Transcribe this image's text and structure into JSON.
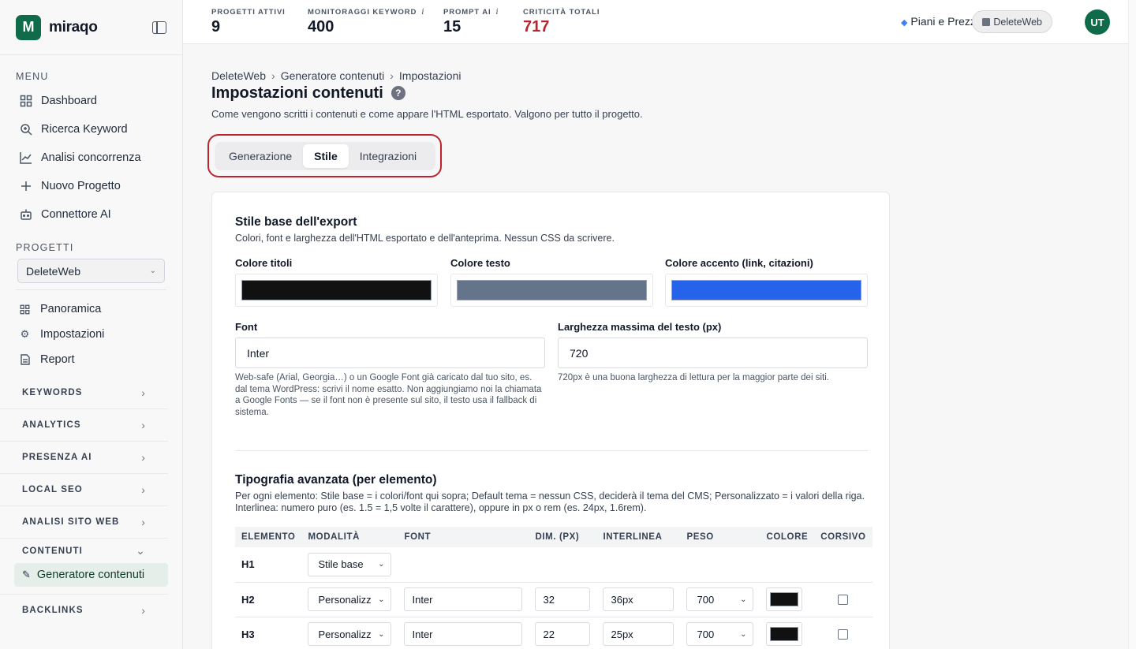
{
  "brand": {
    "name": "miraqo",
    "logo_letter": "M"
  },
  "sidebar": {
    "menu_label": "MENU",
    "menu": [
      {
        "label": "Dashboard",
        "icon": "dashboard-icon"
      },
      {
        "label": "Ricerca Keyword",
        "icon": "search-icon"
      },
      {
        "label": "Analisi concorrenza",
        "icon": "chart-icon"
      },
      {
        "label": "Nuovo Progetto",
        "icon": "plus-icon"
      },
      {
        "label": "Connettore AI",
        "icon": "robot-icon"
      }
    ],
    "projects_label": "PROGETTI",
    "project_selected": "DeleteWeb",
    "project_items": [
      {
        "label": "Panoramica",
        "icon": "grid-icon"
      },
      {
        "label": "Impostazioni",
        "icon": "gear-icon"
      },
      {
        "label": "Report",
        "icon": "document-icon"
      }
    ],
    "groups": [
      "KEYWORDS",
      "ANALYTICS",
      "PRESENZA AI",
      "LOCAL SEO",
      "ANALISI SITO WEB",
      "CONTENUTI"
    ],
    "active_item": "Generatore contenuti",
    "last_group": "BACKLINKS"
  },
  "topbar": {
    "stats": [
      {
        "label": "PROGETTI ATTIVI",
        "value": "9",
        "info": ""
      },
      {
        "label": "MONITORAGGI KEYWORD",
        "value": "400",
        "info": "i"
      },
      {
        "label": "PROMPT AI",
        "value": "15",
        "info": "i"
      },
      {
        "label": "CRITICITÀ TOTALI",
        "value": "717",
        "info": ""
      }
    ],
    "plans": "Piani e Prezzi",
    "workspace": "DeleteWeb",
    "avatar": "UT",
    "accent_red": "#b3262d"
  },
  "breadcrumb": [
    "DeleteWeb",
    "Generatore contenuti",
    "Impostazioni"
  ],
  "page": {
    "title": "Impostazioni contenuti",
    "subtitle": "Come vengono scritti i contenuti e come appare l'HTML esportato. Valgono per tutto il progetto."
  },
  "tabs": [
    {
      "label": "Generazione",
      "active": false
    },
    {
      "label": "Stile",
      "active": true
    },
    {
      "label": "Integrazioni",
      "active": false
    }
  ],
  "style_base": {
    "title": "Stile base dell'export",
    "desc": "Colori, font e larghezza dell'HTML esportato e dell'anteprima. Nessun CSS da scrivere.",
    "colors": [
      {
        "label": "Colore titoli",
        "value": "#111111"
      },
      {
        "label": "Colore testo",
        "value": "#64748b"
      },
      {
        "label": "Colore accento (link, citazioni)",
        "value": "#2563eb"
      }
    ],
    "font_label": "Font",
    "font_value": "Inter",
    "font_hint": "Web-safe (Arial, Georgia…) o un Google Font già caricato dal tuo sito, es. dal tema WordPress: scrivi il nome esatto. Non aggiungiamo noi la chiamata a Google Fonts — se il font non è presente sul sito, il testo usa il fallback di sistema.",
    "width_label": "Larghezza massima del testo (px)",
    "width_value": "720",
    "width_hint": "720px è una buona larghezza di lettura per la maggior parte dei siti."
  },
  "typography": {
    "title": "Tipografia avanzata (per elemento)",
    "desc": "Per ogni elemento: Stile base = i colori/font qui sopra; Default tema = nessun CSS, deciderà il tema del CMS; Personalizzato = i valori della riga. Interlinea: numero puro (es. 1.5 = 1,5 volte il carattere), oppure in px o rem (es. 24px, 1.6rem).",
    "columns": [
      "ELEMENTO",
      "MODALITÀ",
      "FONT",
      "DIM. (PX)",
      "INTERLINEA",
      "PESO",
      "COLORE",
      "CORSIVO"
    ],
    "rows": [
      {
        "element": "H1",
        "mode": "Stile base"
      },
      {
        "element": "H2",
        "mode": "Personalizz",
        "font": "Inter",
        "size": "32",
        "line": "36px",
        "weight": "700",
        "color": "#111111",
        "italic": false
      },
      {
        "element": "H3",
        "mode": "Personalizz",
        "font": "Inter",
        "size": "22",
        "line": "25px",
        "weight": "700",
        "color": "#111111",
        "italic": false
      }
    ]
  }
}
